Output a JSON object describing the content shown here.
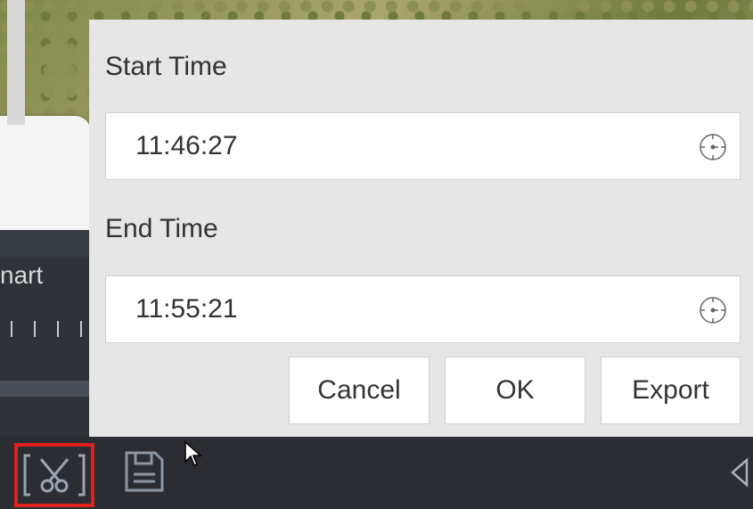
{
  "dialog": {
    "start_time_label": "Start Time",
    "start_time_value": "11:46:27",
    "end_time_label": "End Time",
    "end_time_value": "11:55:21",
    "buttons": {
      "cancel": "Cancel",
      "ok": "OK",
      "export": "Export"
    }
  },
  "timeline": {
    "partial_label": "nart"
  },
  "toolbar": {
    "icons": [
      "clip-icon",
      "save-icon",
      "collapse-icon"
    ],
    "selected_color": "#e0201b"
  }
}
